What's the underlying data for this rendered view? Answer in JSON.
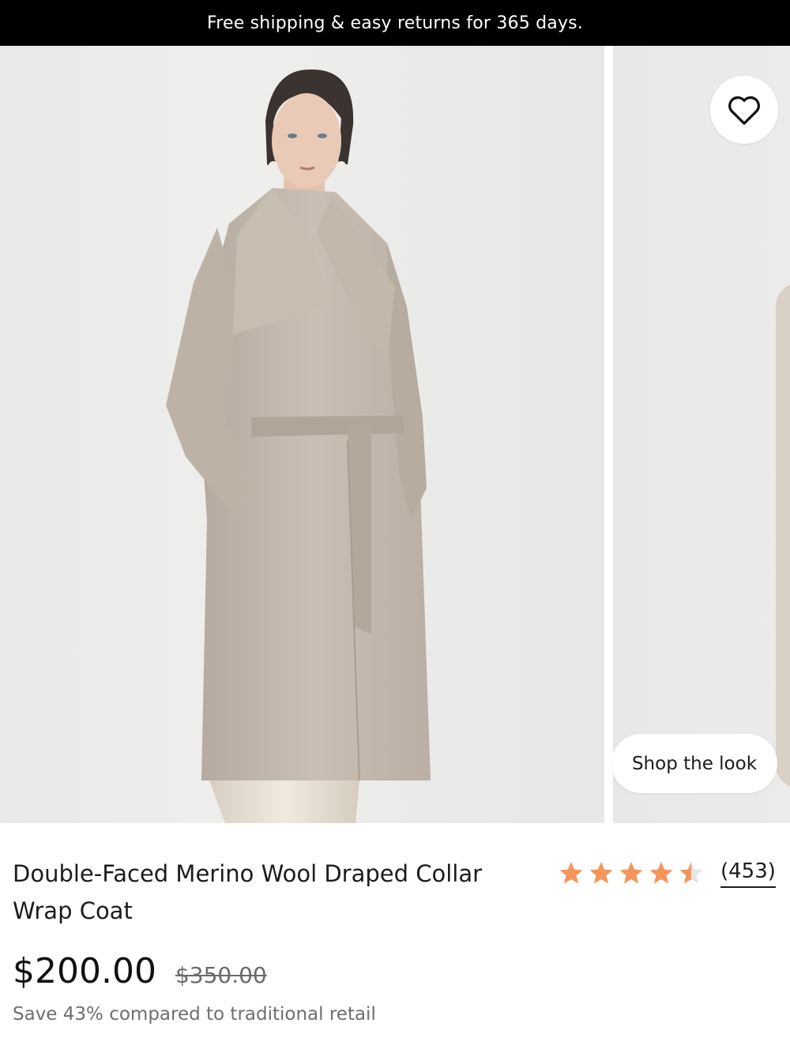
{
  "promo": {
    "text": "Free shipping & easy returns for 365 days."
  },
  "gallery": {
    "shop_the_look_label": "Shop the look",
    "wishlist_icon": "heart-icon"
  },
  "product": {
    "title": "Double-Faced Merino Wool Draped Collar Wrap Coat",
    "rating": {
      "value": 4.5,
      "max": 5,
      "count_label": "(453)",
      "star_color": "#f4955a"
    },
    "price": {
      "current": "$200.00",
      "original": "$350.00"
    },
    "savings_text": "Save 43% compared to traditional retail"
  }
}
